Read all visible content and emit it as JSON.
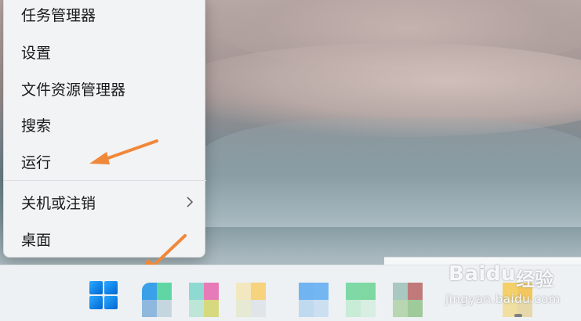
{
  "context_menu": {
    "items": [
      {
        "label": "任务管理器"
      },
      {
        "label": "设置"
      },
      {
        "label": "文件资源管理器"
      },
      {
        "label": "搜索"
      },
      {
        "label": "运行"
      },
      {
        "label": "关机或注销",
        "has_submenu": true
      },
      {
        "label": "桌面"
      }
    ]
  },
  "annotations": {
    "arrow_color": "#f0883a",
    "arrow_icon": "arrow-icon"
  },
  "taskbar": {
    "start_icon": "windows-logo-icon",
    "accent": "#1a8cf0",
    "pinned_apps": [
      {
        "icon": "app-icon-blurred",
        "colors": [
          "#3aa0e8",
          "#5fd6a4",
          "#8fb8de",
          "#c6d6df"
        ]
      },
      {
        "icon": "app-icon-blurred",
        "colors": [
          "#8fd9d3",
          "#e77bb8",
          "#bde6d8",
          "#d7d97f"
        ]
      },
      {
        "icon": "app-icon-blurred",
        "colors": [
          "#f3e7c0",
          "#f6d37c",
          "#e6e9d3",
          "#dfe5e8"
        ]
      },
      {
        "icon": "app-icon-blurred",
        "colors": [
          "#70b4f2",
          "#73b6f1",
          "#bfd9ef",
          "#cbdff0"
        ]
      },
      {
        "icon": "app-icon-blurred",
        "colors": [
          "#7ed9a6",
          "#7fd7a2",
          "#c9ecd6",
          "#d8eee3"
        ]
      },
      {
        "icon": "app-icon-blurred",
        "colors": [
          "#a8c8c0",
          "#c07a7a",
          "#b8d6b2",
          "#9fca9a"
        ]
      },
      {
        "icon": "app-icon-blurred",
        "colors": [
          "#f4d06a",
          "#f3c75e",
          "#f0dfa0",
          "#e6d8a8"
        ]
      }
    ]
  },
  "watermark": {
    "brand": "Baidu",
    "cn": "经验",
    "domain": "jingyan.baidu.com"
  }
}
